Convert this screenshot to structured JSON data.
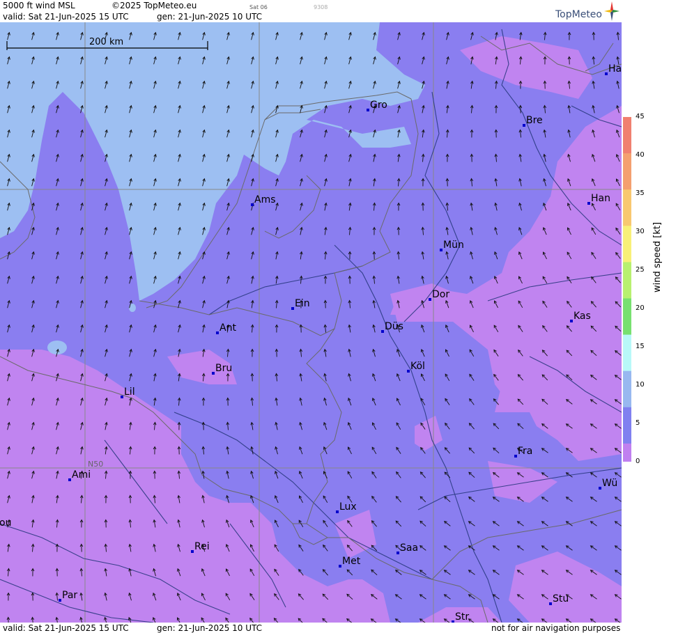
{
  "header": {
    "title": "5000 ft wind MSL",
    "copyright": "©2025 TopMeteo.eu",
    "day_code": "Sat 06",
    "code": "9308",
    "valid": "valid:  Sat  21-Jun-2025  15 UTC",
    "gen": "gen: 21-Jun-2025 10 UTC"
  },
  "logo": {
    "text": "TopMeteo",
    "icon": "compass-star-icon"
  },
  "scale": {
    "label": "200 km"
  },
  "latitude_label": "N50",
  "footer": {
    "valid": "valid:  Sat  21-Jun-2025  15 UTC",
    "gen": "gen: 21-Jun-2025 10 UTC",
    "disclaimer": "not for air navigation purposes"
  },
  "colorbar": {
    "title": "wind  speed  [kt]",
    "ticks": [
      "45",
      "40",
      "35",
      "30",
      "25",
      "20",
      "15",
      "10",
      "5",
      "0"
    ],
    "colors": [
      "#f08070",
      "#f4a070",
      "#f8c870",
      "#f8f078",
      "#b8f070",
      "#78e070",
      "#b8f8f8",
      "#98b8f0",
      "#8080f0",
      "#c080f0"
    ]
  },
  "colors": {
    "light_blue": "#9dbff2",
    "blue_violet": "#8a7ef0",
    "violet": "#c084f0",
    "arrow": "#111111",
    "border": "#6a6a6a",
    "river": "#23357a",
    "city": "#0000cc"
  },
  "cities": [
    {
      "name": "Gro"
    },
    {
      "name": "Bre"
    },
    {
      "name": "Ha"
    },
    {
      "name": "Han"
    },
    {
      "name": "Ams"
    },
    {
      "name": "Mün"
    },
    {
      "name": "Dor"
    },
    {
      "name": "Ein"
    },
    {
      "name": "Kas"
    },
    {
      "name": "Ant"
    },
    {
      "name": "Düs"
    },
    {
      "name": "Köl"
    },
    {
      "name": "Bru"
    },
    {
      "name": "Lil"
    },
    {
      "name": "Fra"
    },
    {
      "name": "Ami"
    },
    {
      "name": "Wü"
    },
    {
      "name": "Lux"
    },
    {
      "name": "ou"
    },
    {
      "name": "Saa"
    },
    {
      "name": "Rei"
    },
    {
      "name": "Met"
    },
    {
      "name": "Par"
    },
    {
      "name": "Stu"
    },
    {
      "name": "Str"
    }
  ]
}
